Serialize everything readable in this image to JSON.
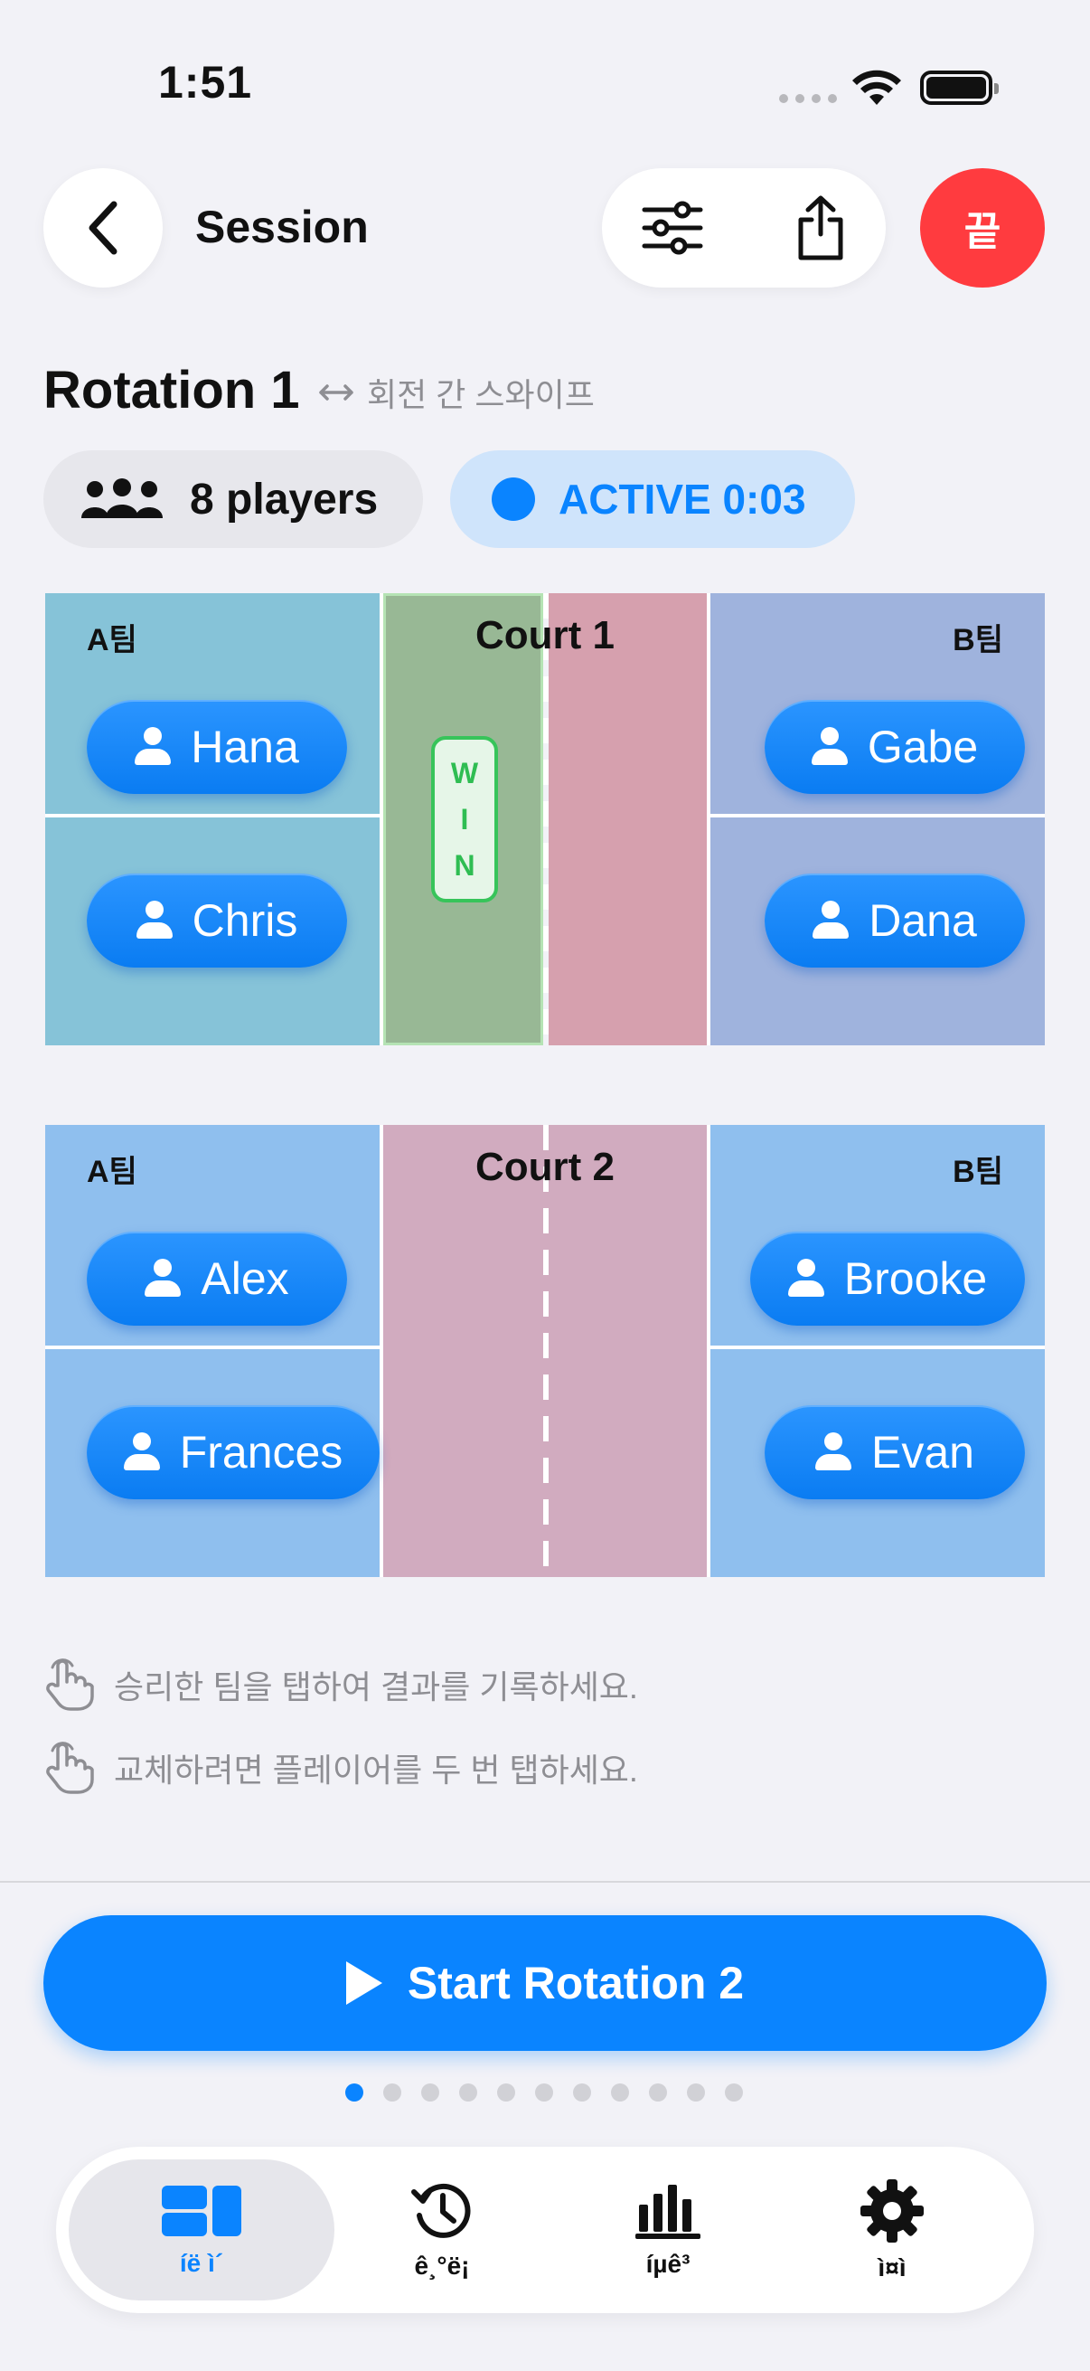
{
  "status": {
    "time": "1:51"
  },
  "header": {
    "title": "Session",
    "end_label": "끝"
  },
  "rotation": {
    "title": "Rotation 1",
    "swipe_hint": "회전 간 스와이프",
    "players": "8 players",
    "active": "ACTIVE 0:03"
  },
  "courts": [
    {
      "name": "Court 1",
      "team_a": "A팀",
      "team_b": "B팀",
      "a_players": [
        "Hana",
        "Chris"
      ],
      "b_players": [
        "Gabe",
        "Dana"
      ],
      "win_letters": [
        "W",
        "I",
        "N"
      ]
    },
    {
      "name": "Court 2",
      "team_a": "A팀",
      "team_b": "B팀",
      "a_players": [
        "Alex",
        "Frances"
      ],
      "b_players": [
        "Brooke",
        "Evan"
      ]
    }
  ],
  "hints": [
    "승리한 팀을 탭하여 결과를 기록하세요.",
    "교체하려면 플레이어를 두 번 탭하세요."
  ],
  "start_button": "Start Rotation 2",
  "pagination": {
    "total": 11,
    "current": 1
  },
  "tabs": [
    {
      "label": "íë ì´",
      "icon": "courts-icon",
      "selected": true
    },
    {
      "label": "ê¸°ë¡",
      "icon": "history-icon",
      "selected": false
    },
    {
      "label": "íµê³",
      "icon": "stats-icon",
      "selected": false
    },
    {
      "label": "ì¤ì ",
      "icon": "gear-icon",
      "selected": false
    }
  ],
  "colors": {
    "accent": "#0a84ff",
    "end_button": "#ff3b3f",
    "court1_team_a": "#86c3d8",
    "court1_team_b": "#9fb3dd",
    "court1_win_side": "#98b895",
    "court1_other_side": "#d6a0ae",
    "court2_team": "#8fbfee",
    "court2_center": "#d1abbf",
    "win_green": "#37c45a"
  }
}
